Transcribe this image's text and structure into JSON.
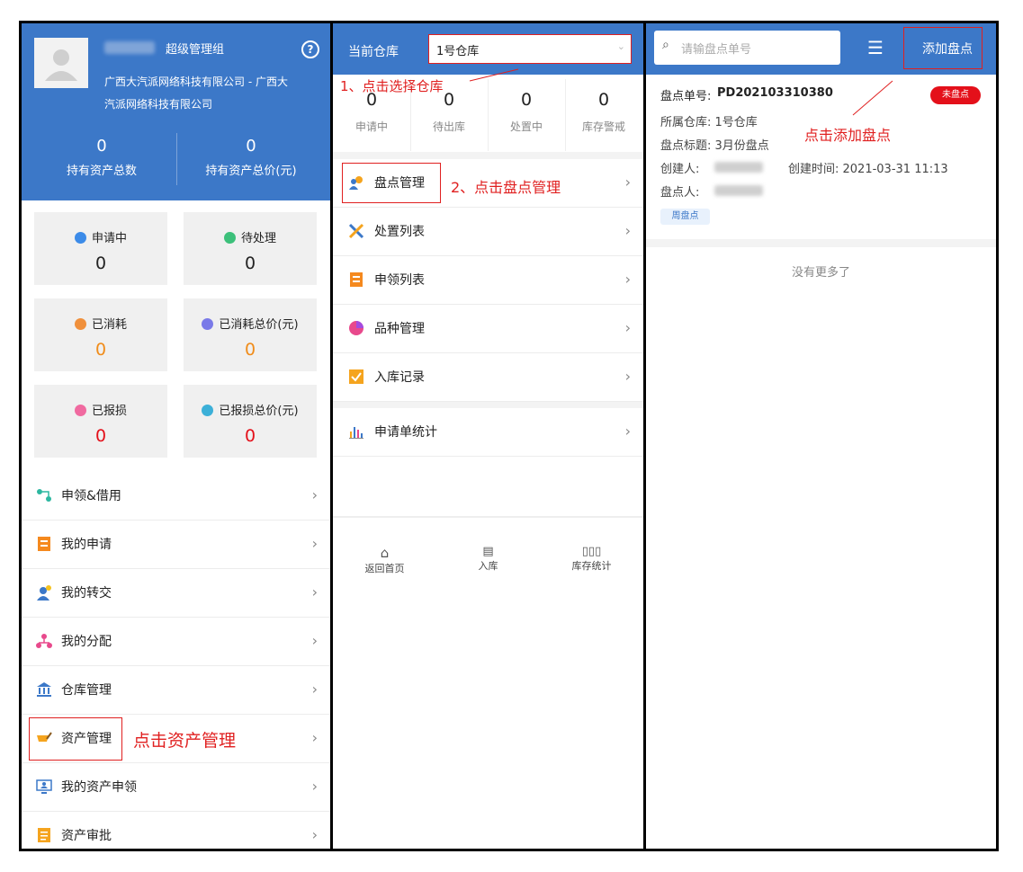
{
  "panel1": {
    "role": "超级管理组",
    "company": [
      "广西大汽派网络科技有限公司 - 广西大",
      "汽派网络科技有限公司"
    ],
    "stats": [
      {
        "value": "0",
        "label": "持有资产总数"
      },
      {
        "value": "0",
        "label": "持有资产总价(元)"
      }
    ],
    "cards": [
      {
        "label": "申请中",
        "value": "0"
      },
      {
        "label": "待处理",
        "value": "0"
      },
      {
        "label": "已消耗",
        "value": "0"
      },
      {
        "label": "已消耗总价(元)",
        "value": "0"
      },
      {
        "label": "已报损",
        "value": "0"
      },
      {
        "label": "已报损总价(元)",
        "value": "0"
      }
    ],
    "menu": [
      "申领&借用",
      "我的申请",
      "我的转交",
      "我的分配",
      "仓库管理",
      "资产管理",
      "我的资产申领",
      "资产审批"
    ],
    "callout": "点击资产管理"
  },
  "panel2": {
    "warehouse_label": "当前仓库",
    "warehouse_value": "1号仓库",
    "callout1": "1、点击选择仓库",
    "counts": [
      {
        "value": "0",
        "label": "申请中"
      },
      {
        "value": "0",
        "label": "待出库"
      },
      {
        "value": "0",
        "label": "处置中"
      },
      {
        "value": "0",
        "label": "库存警戒"
      }
    ],
    "menu": [
      "盘点管理",
      "处置列表",
      "申领列表",
      "品种管理",
      "入库记录"
    ],
    "menu2": [
      "申请单统计"
    ],
    "callout2": "2、点击盘点管理",
    "tabs": [
      "返回首页",
      "入库",
      "库存统计"
    ]
  },
  "panel3": {
    "search_placeholder": "请输盘点单号",
    "add_button": "添加盘点",
    "record": {
      "number_label": "盘点单号:",
      "number": "PD202103310380",
      "status": "未盘点",
      "warehouse": "所属仓库: 1号仓库",
      "title": "盘点标题: 3月份盘点",
      "creator_label": "创建人:",
      "created_time": "创建时间: 2021-03-31 11:13",
      "checker_label": "盘点人:",
      "tag": "周盘点"
    },
    "callout": "点击添加盘点",
    "no_more": "没有更多了"
  },
  "colors": {
    "primary": "#3c78c8",
    "annotation": "#e02020",
    "badge": "#e4101a"
  }
}
